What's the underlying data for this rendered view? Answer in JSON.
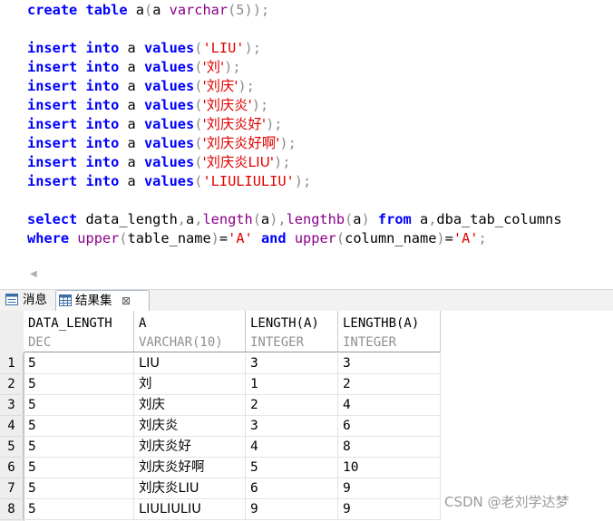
{
  "editor": {
    "lines": [
      {
        "tokens": [
          [
            "kw",
            "create"
          ],
          [
            "id",
            " "
          ],
          [
            "kw",
            "table"
          ],
          [
            "id",
            " a"
          ],
          [
            "pn",
            "("
          ],
          [
            "id",
            "a "
          ],
          [
            "fn",
            "varchar"
          ],
          [
            "pn",
            "(5));"
          ]
        ]
      },
      {
        "tokens": []
      },
      {
        "tokens": [
          [
            "kw",
            "insert"
          ],
          [
            "id",
            " "
          ],
          [
            "kw",
            "into"
          ],
          [
            "id",
            " a "
          ],
          [
            "kw",
            "values"
          ],
          [
            "pn",
            "("
          ],
          [
            "st",
            "'LIU'"
          ],
          [
            "pn",
            ");"
          ]
        ]
      },
      {
        "tokens": [
          [
            "kw",
            "insert"
          ],
          [
            "id",
            " "
          ],
          [
            "kw",
            "into"
          ],
          [
            "id",
            " a "
          ],
          [
            "kw",
            "values"
          ],
          [
            "pn",
            "("
          ],
          [
            "st",
            "'刘'"
          ],
          [
            "pn",
            ");"
          ]
        ]
      },
      {
        "tokens": [
          [
            "kw",
            "insert"
          ],
          [
            "id",
            " "
          ],
          [
            "kw",
            "into"
          ],
          [
            "id",
            " a "
          ],
          [
            "kw",
            "values"
          ],
          [
            "pn",
            "("
          ],
          [
            "st",
            "'刘庆'"
          ],
          [
            "pn",
            ");"
          ]
        ]
      },
      {
        "tokens": [
          [
            "kw",
            "insert"
          ],
          [
            "id",
            " "
          ],
          [
            "kw",
            "into"
          ],
          [
            "id",
            " a "
          ],
          [
            "kw",
            "values"
          ],
          [
            "pn",
            "("
          ],
          [
            "st",
            "'刘庆炎'"
          ],
          [
            "pn",
            ");"
          ]
        ]
      },
      {
        "tokens": [
          [
            "kw",
            "insert"
          ],
          [
            "id",
            " "
          ],
          [
            "kw",
            "into"
          ],
          [
            "id",
            " a "
          ],
          [
            "kw",
            "values"
          ],
          [
            "pn",
            "("
          ],
          [
            "st",
            "'刘庆炎好'"
          ],
          [
            "pn",
            ");"
          ]
        ]
      },
      {
        "tokens": [
          [
            "kw",
            "insert"
          ],
          [
            "id",
            " "
          ],
          [
            "kw",
            "into"
          ],
          [
            "id",
            " a "
          ],
          [
            "kw",
            "values"
          ],
          [
            "pn",
            "("
          ],
          [
            "st",
            "'刘庆炎好啊'"
          ],
          [
            "pn",
            ");"
          ]
        ]
      },
      {
        "tokens": [
          [
            "kw",
            "insert"
          ],
          [
            "id",
            " "
          ],
          [
            "kw",
            "into"
          ],
          [
            "id",
            " a "
          ],
          [
            "kw",
            "values"
          ],
          [
            "pn",
            "("
          ],
          [
            "st",
            "'刘庆炎LIU'"
          ],
          [
            "pn",
            ");"
          ]
        ]
      },
      {
        "tokens": [
          [
            "kw",
            "insert"
          ],
          [
            "id",
            " "
          ],
          [
            "kw",
            "into"
          ],
          [
            "id",
            " a "
          ],
          [
            "kw",
            "values"
          ],
          [
            "pn",
            "("
          ],
          [
            "st",
            "'LIULIULIU'"
          ],
          [
            "pn",
            ");"
          ]
        ]
      },
      {
        "tokens": []
      },
      {
        "tokens": [
          [
            "kw",
            "select"
          ],
          [
            "id",
            " data_length"
          ],
          [
            "pn",
            ","
          ],
          [
            "id",
            "a"
          ],
          [
            "pn",
            ","
          ],
          [
            "fn",
            "length"
          ],
          [
            "pn",
            "("
          ],
          [
            "id",
            "a"
          ],
          [
            "pn",
            ")"
          ],
          [
            "pn",
            ","
          ],
          [
            "fn",
            "lengthb"
          ],
          [
            "pn",
            "("
          ],
          [
            "id",
            "a"
          ],
          [
            "pn",
            ")"
          ],
          [
            "id",
            " "
          ],
          [
            "kw",
            "from"
          ],
          [
            "id",
            " a"
          ],
          [
            "pn",
            ","
          ],
          [
            "id",
            "dba_tab_columns"
          ]
        ]
      },
      {
        "tokens": [
          [
            "kw",
            "where"
          ],
          [
            "id",
            " "
          ],
          [
            "fn",
            "upper"
          ],
          [
            "pn",
            "("
          ],
          [
            "id",
            "table_name"
          ],
          [
            "pn",
            ")"
          ],
          [
            "id",
            "="
          ],
          [
            "st",
            "'A'"
          ],
          [
            "id",
            " "
          ],
          [
            "kw",
            "and"
          ],
          [
            "id",
            " "
          ],
          [
            "fn",
            "upper"
          ],
          [
            "pn",
            "("
          ],
          [
            "id",
            "column_name"
          ],
          [
            "pn",
            ")"
          ],
          [
            "id",
            "="
          ],
          [
            "st",
            "'A'"
          ],
          [
            "pn",
            ";"
          ]
        ]
      }
    ]
  },
  "tabs": {
    "messages_label": "消息",
    "results_label": "结果集",
    "close_glyph": "⊠"
  },
  "grid": {
    "columns": [
      {
        "name": "DATA_LENGTH",
        "type": "DEC"
      },
      {
        "name": "A",
        "type": "VARCHAR(10)"
      },
      {
        "name": "LENGTH(A)",
        "type": "INTEGER"
      },
      {
        "name": "LENGTHB(A)",
        "type": "INTEGER"
      }
    ],
    "rows": [
      {
        "n": "1",
        "cells": [
          "5",
          "LIU",
          "3",
          "3"
        ]
      },
      {
        "n": "2",
        "cells": [
          "5",
          "刘",
          "1",
          "2"
        ]
      },
      {
        "n": "3",
        "cells": [
          "5",
          "刘庆",
          "2",
          "4"
        ]
      },
      {
        "n": "4",
        "cells": [
          "5",
          "刘庆炎",
          "3",
          "6"
        ]
      },
      {
        "n": "5",
        "cells": [
          "5",
          "刘庆炎好",
          "4",
          "8"
        ]
      },
      {
        "n": "6",
        "cells": [
          "5",
          "刘庆炎好啊",
          "5",
          "10"
        ]
      },
      {
        "n": "7",
        "cells": [
          "5",
          "刘庆炎LIU",
          "6",
          "9"
        ]
      },
      {
        "n": "8",
        "cells": [
          "5",
          "LIULIULIU",
          "9",
          "9"
        ]
      }
    ]
  },
  "scroll": {
    "left_arrow": "◀"
  },
  "watermark": "CSDN @老刘学达梦",
  "colors": {
    "keyword": "#0000ff",
    "function": "#8b008b",
    "string": "#e00000",
    "punct": "#8c8c8c",
    "type_text": "#909090"
  }
}
